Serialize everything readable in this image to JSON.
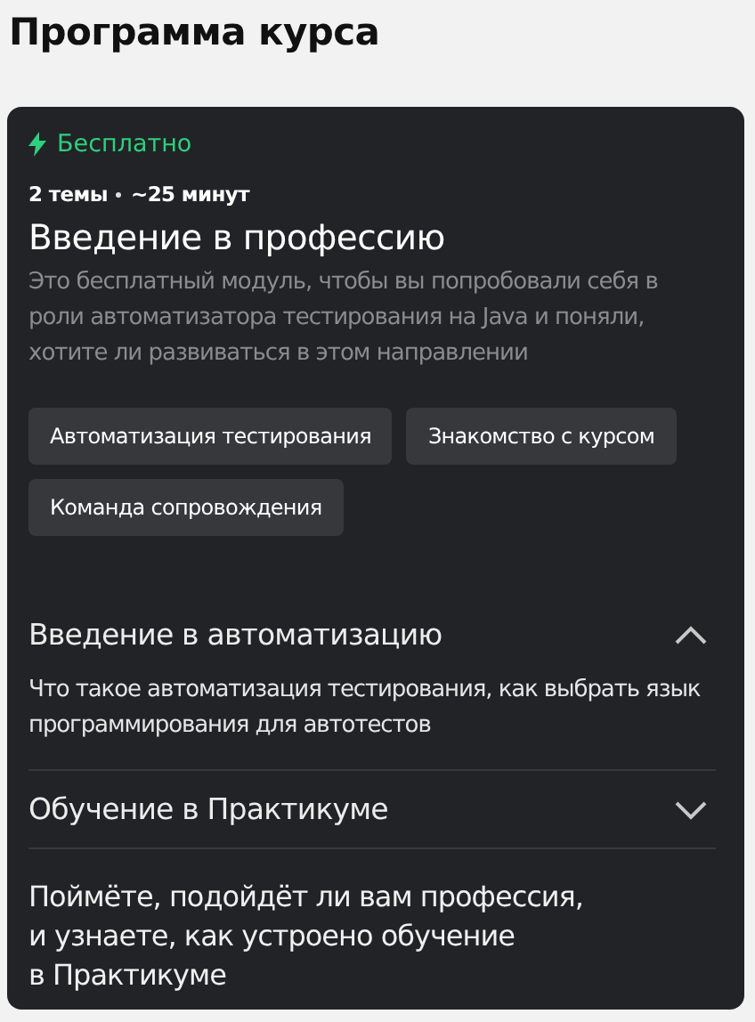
{
  "page_title": "Программа курса",
  "module": {
    "badge": "Бесплатно",
    "topics": "2 темы",
    "duration": "~25 минут",
    "title": "Введение в профессию",
    "description": "Это бесплатный модуль, чтобы вы попробовали себя в роли автоматизатора тестирования на Java и поняли, хотите ли развиваться в этом направлении",
    "tags": [
      "Автоматизация тестирования",
      "Знакомство с курсом",
      "Команда сопровождения"
    ],
    "sections": [
      {
        "title": "Введение в автоматизацию",
        "expanded": true,
        "description": "Что такое автоматизация тестирования, как выбрать язык программирования для автотестов"
      },
      {
        "title": "Обучение в Практикуме",
        "expanded": false
      }
    ],
    "summary": "Поймёте, подойдёт ли вам профессия,\nи узнаете, как устроено обучение\nв Практикуме"
  }
}
